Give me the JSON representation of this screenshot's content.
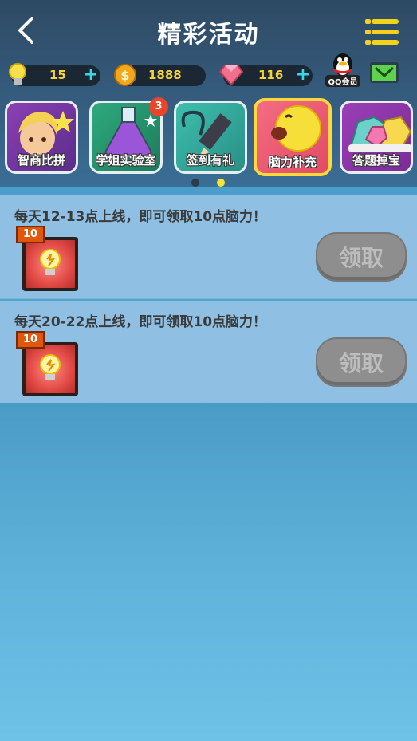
{
  "header": {
    "title": "精彩活动",
    "back_icon": "chevron-left-icon",
    "menu_icon": "menu-icon"
  },
  "resources": {
    "energy": {
      "value": "15",
      "icon": "lightbulb-icon"
    },
    "coins": {
      "value": "1888",
      "icon": "dollar-coin-icon"
    },
    "gems": {
      "value": "116",
      "icon": "diamond-icon"
    },
    "qq_label": "QQ会员"
  },
  "activities": [
    {
      "label": "智商比拼",
      "icon": "smart-kid-icon",
      "badge": ""
    },
    {
      "label": "学姐实验室",
      "icon": "flask-icon",
      "badge": "3"
    },
    {
      "label": "签到有礼",
      "icon": "pen-icon",
      "badge": ""
    },
    {
      "label": "脑力补充",
      "icon": "yellow-face-icon",
      "badge": ""
    },
    {
      "label": "答题掉宝",
      "icon": "gems-pile-icon",
      "badge": ""
    }
  ],
  "rewards": [
    {
      "text": "每天12-13点上线，即可领取10点脑力！",
      "count": "10",
      "button": "领取"
    },
    {
      "text": "每天20-22点上线，即可领取10点脑力！",
      "count": "10",
      "button": "领取"
    }
  ],
  "colors": {
    "accent_yellow": "#f3d21c",
    "plus_cyan": "#39d7ec",
    "badge_red": "#e8452d",
    "button_disabled": "#8e8e8e"
  }
}
